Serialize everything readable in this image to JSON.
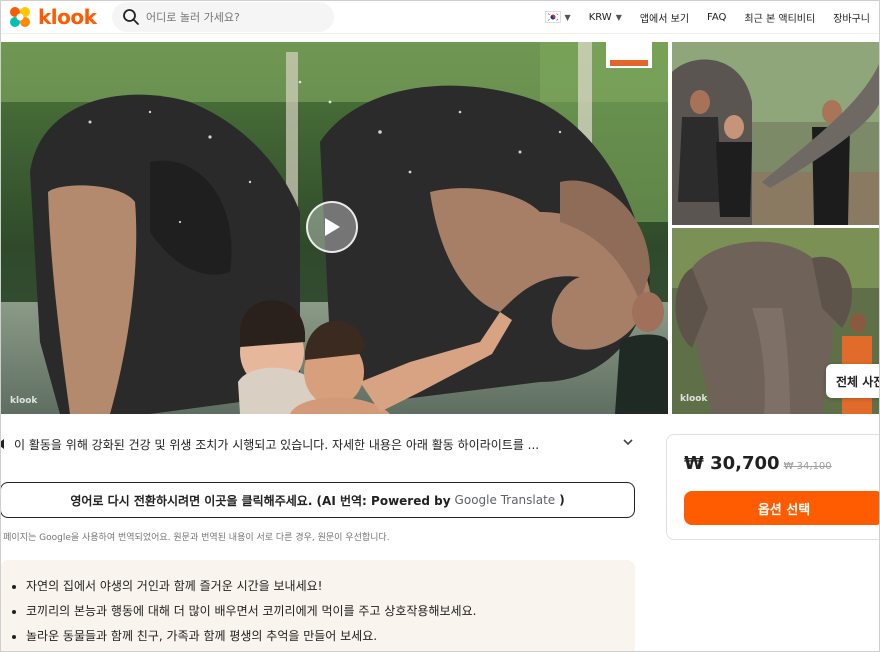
{
  "header": {
    "brand": "klook",
    "search_placeholder": "어디로 놀러 가세요?",
    "currency": "KRW",
    "nav_app": "앱에서 보기",
    "nav_faq": "FAQ",
    "nav_recent": "최근 본 액티비티",
    "nav_cart": "장바구니"
  },
  "gallery": {
    "watermark_main": "klook",
    "watermark_side": "klook",
    "view_all": "전체 사진 보기"
  },
  "content": {
    "notice": "이 활동을 위해 강화된 건강 및 위생 조치가 시행되고 있습니다. 자세한 내용은 아래 활동 하이라이트를 ...",
    "translate_prefix": "영어로 다시 전환하시려면 이곳을 클릭해주세요. (AI 번역: Powered by",
    "translate_google": "Google",
    "translate_product": "Translate",
    "translate_suffix": ")",
    "disclaimer": "이 페이지는 Google을 사용하여 번역되었어요. 원문과 번역된 내용이 서로 다른 경우, 원문이 우선합니다.",
    "highlights": [
      "자연의 집에서 야생의 거인과 함께 즐거운 시간을 보내세요!",
      "코끼리의 본능과 행동에 대해 더 많이 배우면서 코끼리에게 먹이를 주고 상호작용해보세요.",
      "놀라운 동물들과 함께 친구, 가족과 함께 평생의 추억을 만들어 보세요."
    ]
  },
  "booking": {
    "price": "₩ 30,700",
    "original_price": "₩ 34,100",
    "button": "옵션 선택"
  },
  "colors": {
    "brand": "#ff5b00",
    "highlight_bg": "#faf4ee"
  }
}
